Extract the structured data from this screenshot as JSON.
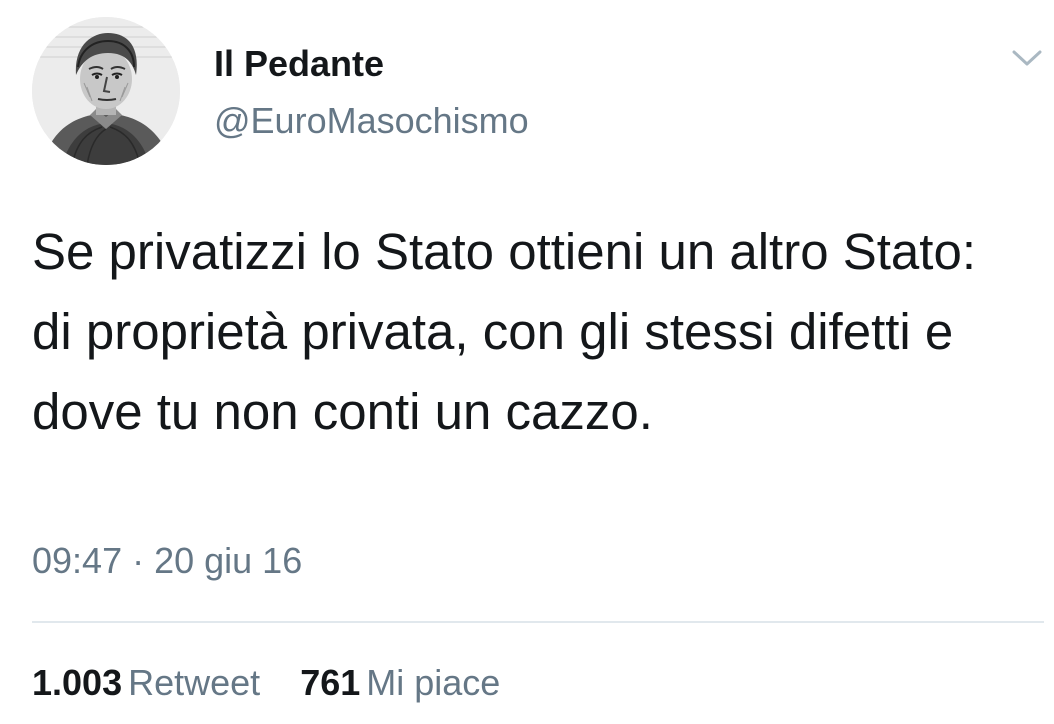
{
  "tweet": {
    "author": {
      "display_name": "Il Pedante",
      "handle": "@EuroMasochismo"
    },
    "text": "Se privatizzi lo Stato ottieni un altro Stato: di proprietà privata, con gli stessi difetti e dove tu non conti un cazzo.",
    "timestamp": "09:47 · 20 giu 16",
    "stats": {
      "retweets_count": "1.003",
      "retweets_label": "Retweet",
      "likes_count": "761",
      "likes_label": "Mi piace"
    }
  },
  "icons": {
    "menu": "chevron-down-icon",
    "avatar": "engraved-portrait"
  },
  "colors": {
    "primary_text": "#14171a",
    "secondary_text": "#657786",
    "divider": "#e1e8ed",
    "caret": "#aab8c2"
  }
}
